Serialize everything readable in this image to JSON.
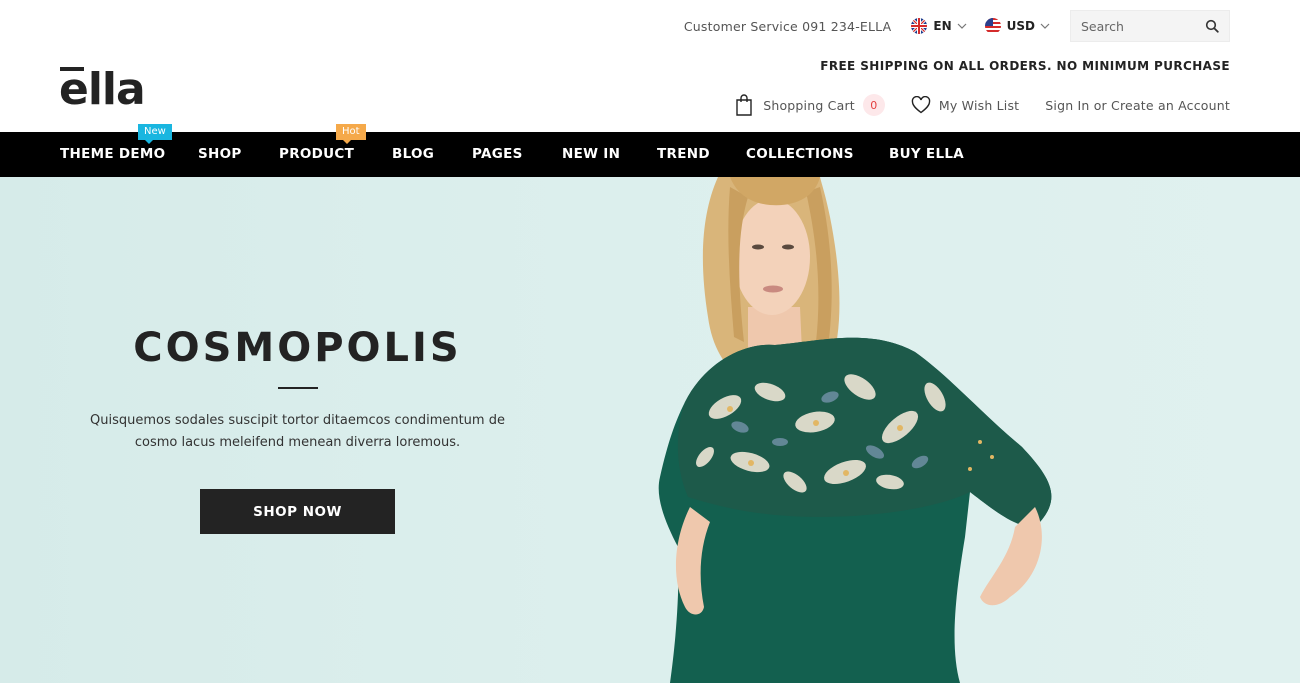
{
  "brand": {
    "logo_text": "ella"
  },
  "topbar": {
    "customer_service": "Customer Service 091 234-ELLA",
    "language": "EN",
    "currency": "USD",
    "search_placeholder": "Search"
  },
  "shipping_notice": "FREE SHIPPING ON ALL ORDERS. NO MINIMUM PURCHASE",
  "account": {
    "cart_label": "Shopping Cart",
    "cart_count": "0",
    "wishlist_label": "My Wish List",
    "signin_label": "Sign In or Create an Account"
  },
  "nav": {
    "items": [
      {
        "label": "THEME DEMO",
        "badge": "New"
      },
      {
        "label": "SHOP"
      },
      {
        "label": "PRODUCT",
        "badge": "Hot"
      },
      {
        "label": "BLOG"
      },
      {
        "label": "PAGES"
      },
      {
        "label": "NEW IN"
      },
      {
        "label": "TREND"
      },
      {
        "label": "COLLECTIONS"
      },
      {
        "label": "BUY ELLA"
      }
    ]
  },
  "hero": {
    "title": "COSMOPOLIS",
    "description": "Quisquemos sodales suscipit tortor ditaemcos condimentum de cosmo lacus meleifend menean diverra loremous.",
    "cta_label": "SHOP NOW"
  },
  "colors": {
    "nav_bg": "#000000",
    "hero_bg": "#dcefed",
    "badge_new": "#19b6e0",
    "badge_hot": "#f5a94a",
    "cart_count_bg": "#fde8ea",
    "button_bg": "#232323",
    "blouse": "#13604f"
  },
  "icons": {
    "search": "search-icon",
    "cart": "shopping-bag-icon",
    "wishlist": "heart-icon",
    "language_flag": "uk-flag-icon",
    "currency_flag": "us-flag-icon",
    "dropdown": "chevron-down-icon"
  }
}
